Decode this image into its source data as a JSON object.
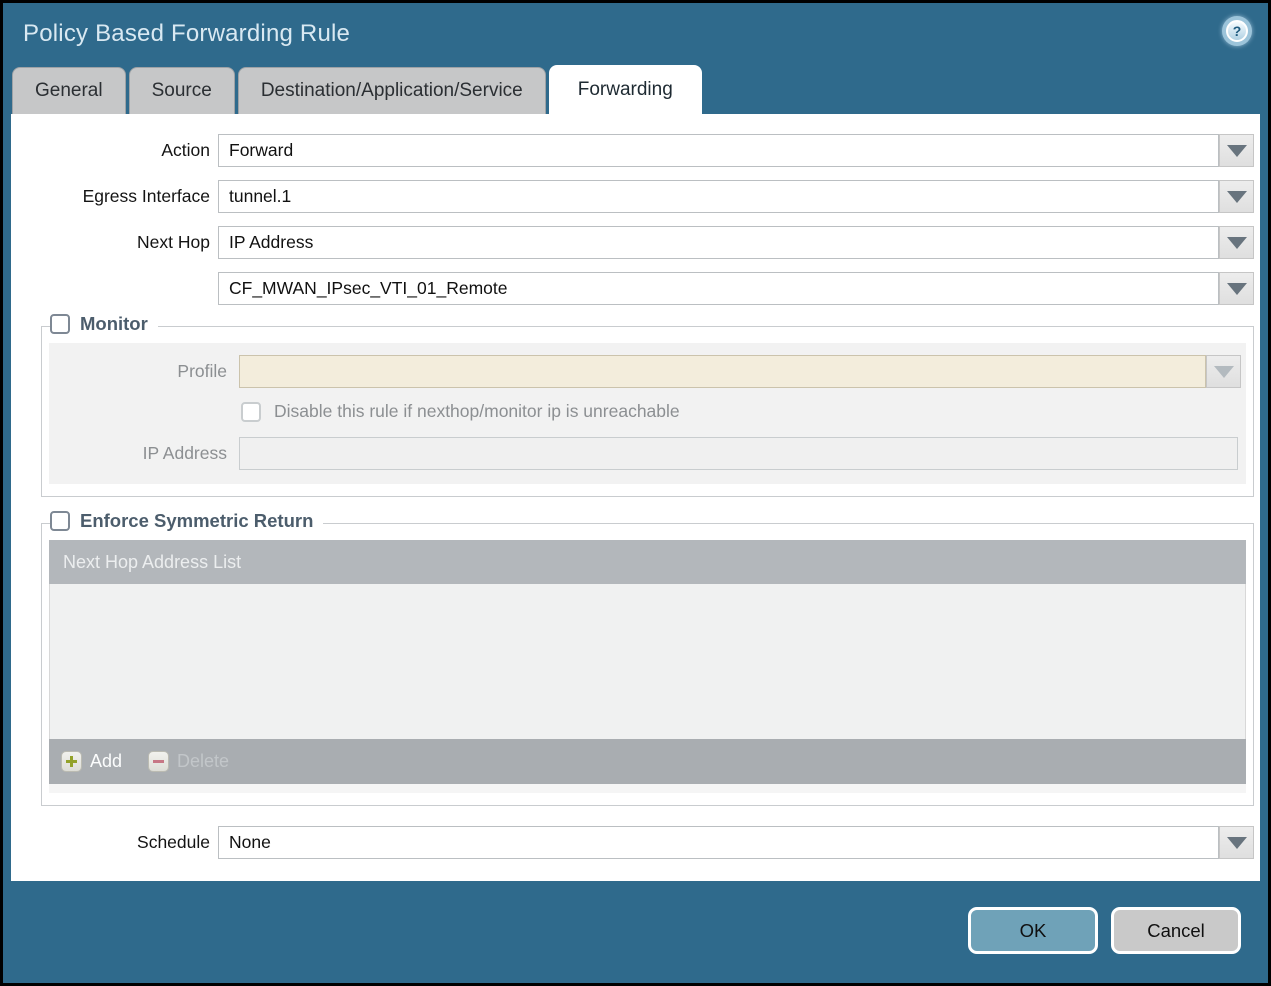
{
  "dialog": {
    "title": "Policy Based Forwarding Rule",
    "help_icon": "?"
  },
  "tabs": [
    {
      "label": "General",
      "active": false
    },
    {
      "label": "Source",
      "active": false
    },
    {
      "label": "Destination/Application/Service",
      "active": false
    },
    {
      "label": "Forwarding",
      "active": true
    }
  ],
  "form": {
    "action": {
      "label": "Action",
      "value": "Forward"
    },
    "egress_interface": {
      "label": "Egress Interface",
      "value": "tunnel.1"
    },
    "next_hop": {
      "label": "Next Hop",
      "value": "IP Address"
    },
    "next_hop_address": {
      "value": "CF_MWAN_IPsec_VTI_01_Remote"
    },
    "schedule": {
      "label": "Schedule",
      "value": "None"
    }
  },
  "monitor": {
    "legend": "Monitor",
    "checked": false,
    "profile": {
      "label": "Profile",
      "value": ""
    },
    "disable_rule": {
      "label": "Disable this rule if nexthop/monitor ip is unreachable",
      "checked": false
    },
    "ip_address": {
      "label": "IP Address",
      "value": ""
    }
  },
  "symmetric_return": {
    "legend": "Enforce Symmetric Return",
    "checked": false,
    "table_header": "Next Hop Address List",
    "rows": [],
    "add_label": "Add",
    "delete_label": "Delete"
  },
  "footer": {
    "ok_label": "OK",
    "cancel_label": "Cancel"
  },
  "colors": {
    "chrome_teal": "#2F6A8C",
    "title_text": "#D9E9F2",
    "tab_inactive": "#C6C7C8",
    "tab_active": "#FFFFFF",
    "legend_text": "#4C5D6C",
    "disabled_field_beige": "#F3EDDC",
    "table_header_bg": "#B3B7BB",
    "table_footer_bg": "#A9ADB1",
    "ok_button": "#6FA2B8",
    "cancel_button": "#C9C9C9",
    "add_plus": "#93A229",
    "delete_minus": "#C77785"
  }
}
